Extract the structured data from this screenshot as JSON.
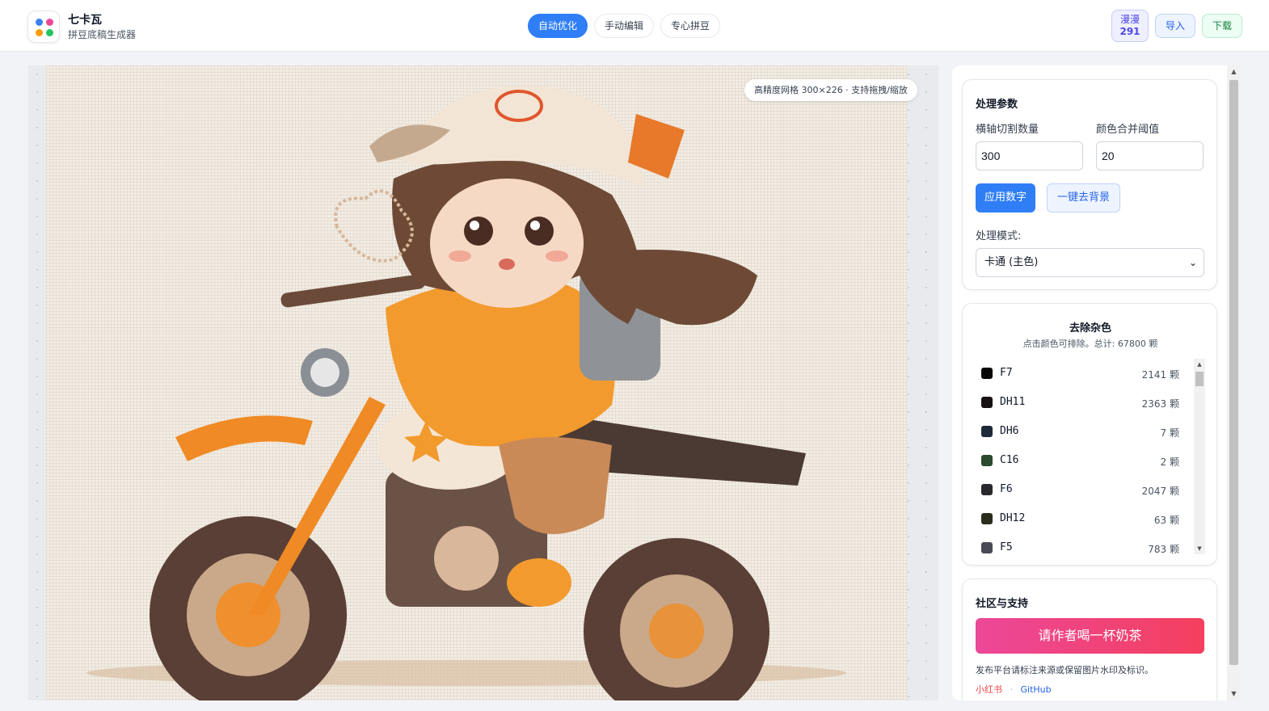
{
  "app": {
    "title": "七卡瓦",
    "subtitle": "拼豆底稿生成器"
  },
  "logo_colors": [
    "#3b82f6",
    "#ec4899",
    "#f59e0b",
    "#22c55e"
  ],
  "tabs": [
    {
      "label": "自动优化",
      "active": true
    },
    {
      "label": "手动编辑",
      "active": false
    },
    {
      "label": "专心拼豆",
      "active": false
    }
  ],
  "header_buttons": {
    "badge_label": "漫漫",
    "badge_count": "291",
    "import": "导入",
    "download": "下载"
  },
  "canvas": {
    "grid_info": "高精度网格 300×226 · 支持拖拽/缩放",
    "image_description_icon": "pixel-art-motorcycle-girl"
  },
  "params": {
    "title": "处理参数",
    "axis_label": "横轴切割数量",
    "axis_value": "300",
    "threshold_label": "颜色合并阈值",
    "threshold_value": "20",
    "apply_button": "应用数字",
    "remove_bg_button": "一键去背景",
    "mode_label": "处理模式:",
    "mode_value": "卡通 (主色)"
  },
  "noise": {
    "title": "去除杂色",
    "subtitle": "点击颜色可排除。总计: 67800 颗",
    "colors": [
      {
        "code": "F7",
        "count": "2141 颗",
        "hex": "#050505"
      },
      {
        "code": "DH11",
        "count": "2363 颗",
        "hex": "#161214"
      },
      {
        "code": "DH6",
        "count": "7 颗",
        "hex": "#1e2a3a"
      },
      {
        "code": "C16",
        "count": "2 颗",
        "hex": "#2b4a2f"
      },
      {
        "code": "F6",
        "count": "2047 颗",
        "hex": "#29282c"
      },
      {
        "code": "DH12",
        "count": "63 颗",
        "hex": "#2a2d1c"
      },
      {
        "code": "F5",
        "count": "783 颗",
        "hex": "#4a4a55"
      }
    ]
  },
  "community": {
    "title": "社区与支持",
    "tea_button": "请作者喝一杯奶茶",
    "note": "发布平台请标注来源或保留图片水印及标识。",
    "link_xhs": "小红书",
    "separator": "·",
    "link_github": "GitHub"
  }
}
